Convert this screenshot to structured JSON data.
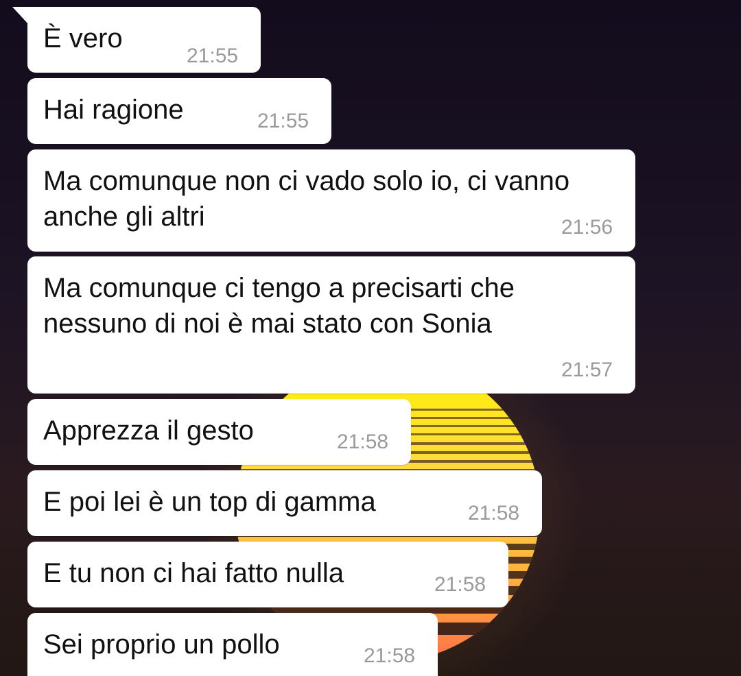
{
  "wallpaper": {
    "background": "#140f1e",
    "sun_top": "#fff200",
    "sun_mid": "#ffb03a",
    "sun_bottom": "#ff6a4a"
  },
  "messages": [
    {
      "text": "È vero",
      "time": "21:55"
    },
    {
      "text": "Hai ragione",
      "time": "21:55"
    },
    {
      "lines": [
        "Ma comunque non ci vado solo io, ci vanno",
        "anche gli altri"
      ],
      "time": "21:56"
    },
    {
      "lines": [
        "Ma comunque ci tengo a precisarti che",
        "nessuno di noi è mai stato con Sonia"
      ],
      "time": "21:57"
    },
    {
      "text": "Apprezza il gesto",
      "time": "21:58"
    },
    {
      "text": "E poi lei è un top di gamma",
      "time": "21:58"
    },
    {
      "text": "E tu non ci hai fatto nulla",
      "time": "21:58"
    },
    {
      "text": "Sei proprio un pollo",
      "time": "21:58"
    }
  ]
}
